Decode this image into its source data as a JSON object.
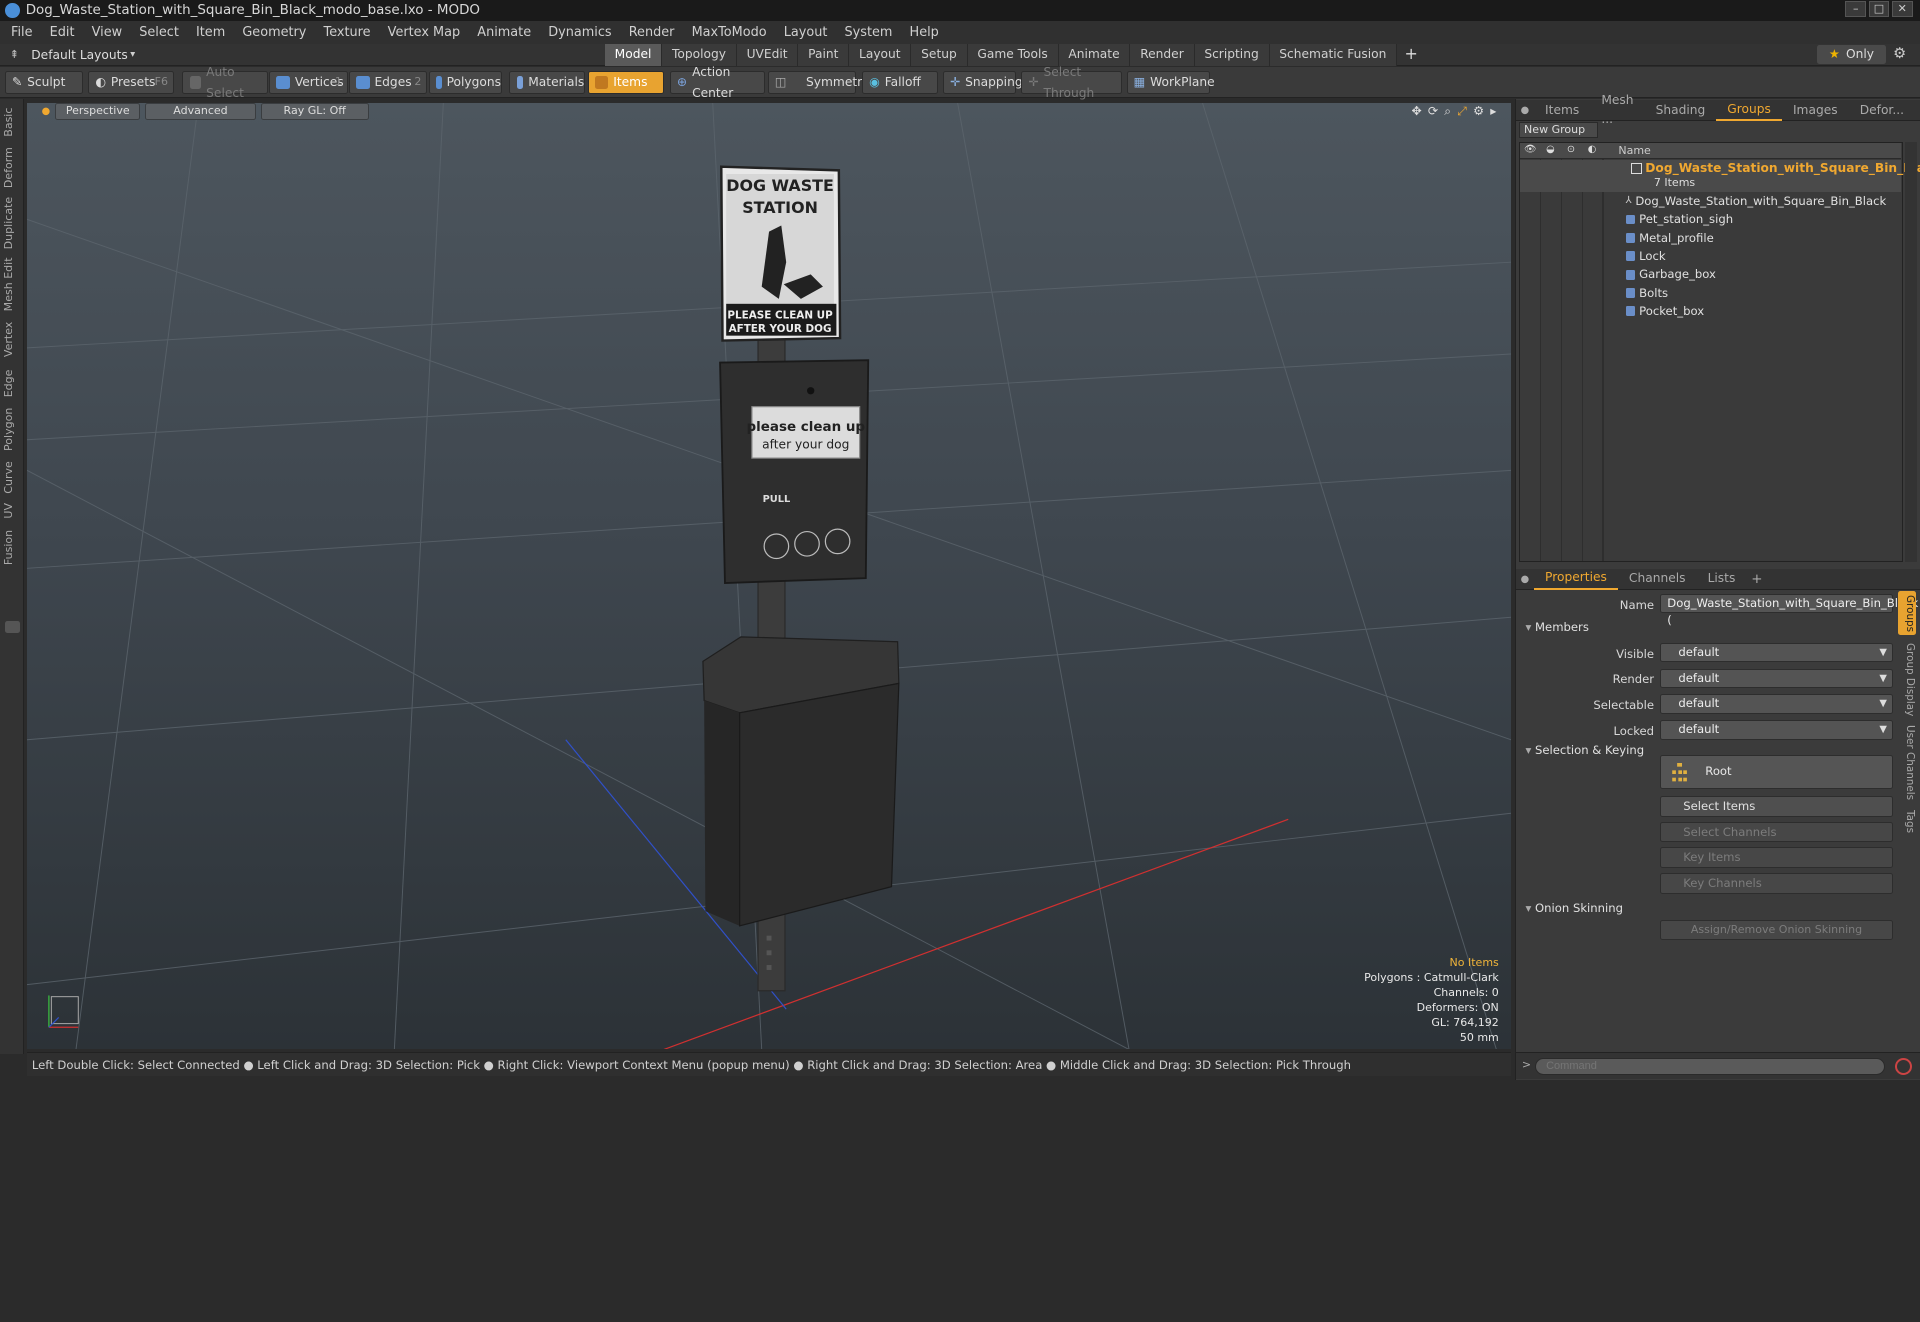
{
  "window": {
    "title": "Dog_Waste_Station_with_Square_Bin_Black_modo_base.lxo - MODO"
  },
  "menu": [
    "File",
    "Edit",
    "View",
    "Select",
    "Item",
    "Geometry",
    "Texture",
    "Vertex Map",
    "Animate",
    "Dynamics",
    "Render",
    "MaxToModo",
    "Layout",
    "System",
    "Help"
  ],
  "layout_bar": {
    "layout_label": "Default Layouts",
    "tabs": [
      "Model",
      "Topology",
      "UVEdit",
      "Paint",
      "Layout",
      "Setup",
      "Game Tools",
      "Animate",
      "Render",
      "Scripting",
      "Schematic Fusion"
    ],
    "active_tab": "Model",
    "only_label": "Only"
  },
  "toolbar": {
    "sculpt": "Sculpt",
    "presets": "Presets",
    "presets_key": "F6",
    "auto_select": "Auto Select",
    "vertices": "Vertices",
    "vertices_key": "1",
    "edges": "Edges",
    "edges_key": "2",
    "polygons": "Polygons",
    "materials": "Materials",
    "items": "Items",
    "action_center": "Action Center",
    "symmetry": "Symmetry",
    "falloff": "Falloff",
    "snapping": "Snapping",
    "select_through": "Select Through",
    "workplane": "WorkPlane"
  },
  "left_tabs": [
    "Basic",
    "Deform",
    "Duplicate",
    "Mesh Edit",
    "Vertex",
    "Edge",
    "Polygon",
    "Curve",
    "UV",
    "Fusion"
  ],
  "viewport": {
    "view_mode": "Perspective",
    "shading": "Advanced",
    "raygl": "Ray GL: Off",
    "info": {
      "no_items": "No Items",
      "polygons": "Polygons : Catmull-Clark",
      "channels": "Channels: 0",
      "deformers": "Deformers: ON",
      "gl": "GL: 764,192",
      "focal": "50 mm"
    }
  },
  "status_bar": "Left Double Click: Select Connected ● Left Click and Drag: 3D Selection: Pick ● Right Click: Viewport Context Menu (popup menu) ● Right Click and Drag: 3D Selection: Area ● Middle Click and Drag: 3D Selection: Pick Through",
  "right_panel": {
    "top_tabs": [
      "Items",
      "Mesh ...",
      "Shading",
      "Groups",
      "Images",
      "Defor..."
    ],
    "active_top_tab": "Groups",
    "new_group": "New Group",
    "name_col": "Name",
    "group": {
      "name": "Dog_Waste_Station_with_Square_Bin_Bla ...",
      "count": "7 Items",
      "members": [
        "Dog_Waste_Station_with_Square_Bin_Black",
        "Pet_station_sigh",
        "Metal_profile",
        "Lock",
        "Garbage_box",
        "Bolts",
        "Pocket_box"
      ]
    },
    "prop_tabs": [
      "Properties",
      "Channels",
      "Lists"
    ],
    "active_prop_tab": "Properties",
    "properties": {
      "name_label": "Name",
      "name_value": "Dog_Waste_Station_with_Square_Bin_Black (",
      "members_section": "Members",
      "visible_label": "Visible",
      "visible_value": "default",
      "render_label": "Render",
      "render_value": "default",
      "selectable_label": "Selectable",
      "selectable_value": "default",
      "locked_label": "Locked",
      "locked_value": "default",
      "selkey_section": "Selection & Keying",
      "root": "Root",
      "select_items": "Select Items",
      "select_channels": "Select Channels",
      "key_items": "Key Items",
      "key_channels": "Key Channels",
      "onion_section": "Onion Skinning",
      "onion_btn": "Assign/Remove Onion Skinning"
    },
    "side_tabs": [
      "Groups",
      "Group Display",
      "User Channels",
      "Tags"
    ],
    "command_placeholder": "Command"
  },
  "colors": {
    "accent": "#e8a330",
    "group_name": "#f0a830",
    "axis_x": "#d03030",
    "axis_z": "#3050c8"
  },
  "model_decals": {
    "sign_title": "DOG WASTE STATION",
    "sign_footer": "PLEASE CLEAN UP AFTER YOUR DOG",
    "dispenser_line1": "please clean up",
    "dispenser_line2": "after your dog",
    "dispenser_pull": "PULL"
  }
}
